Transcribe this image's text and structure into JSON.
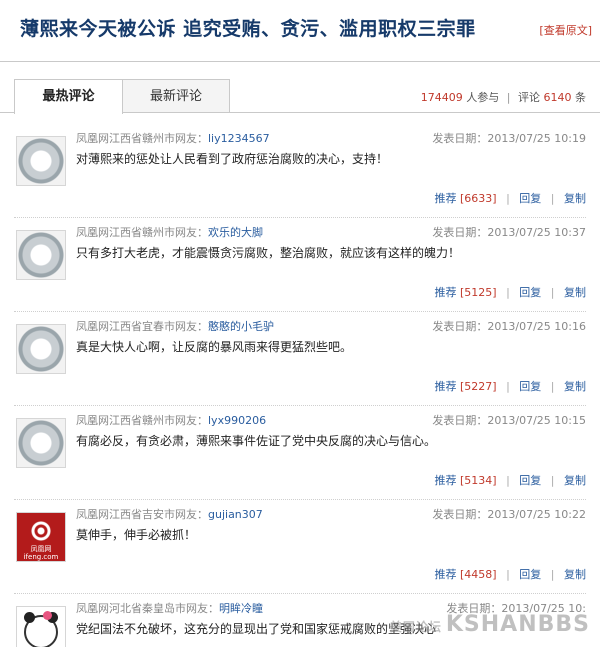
{
  "article": {
    "headline": "薄熙来今天被公诉 追究受贿、贪污、滥用职权三宗罪",
    "view_original": "[查看原文]"
  },
  "tabs": {
    "hot": "最热评论",
    "latest": "最新评论"
  },
  "stats": {
    "participants": "174409",
    "participants_suffix": "人参与",
    "comments_prefix": "评论",
    "comments": "6140",
    "comments_suffix": "条"
  },
  "actions": {
    "like": "推荐",
    "reply": "回复",
    "copy": "复制"
  },
  "comments": [
    {
      "source": "凤凰网江西省赣州市网友：",
      "user": "liy1234567",
      "date": "发表日期：2013/07/25 10:19",
      "text": "对薄熙来的惩处让人民看到了政府惩治腐败的决心，支持！",
      "likes": "[6633]",
      "avatar": "default"
    },
    {
      "source": "凤凰网江西省赣州市网友：",
      "user": "欢乐的大脚",
      "date": "发表日期：2013/07/25 10:37",
      "text": "只有多打大老虎，才能震慑贪污腐败，整治腐败，就应该有这样的魄力！",
      "likes": "[5125]",
      "avatar": "default"
    },
    {
      "source": "凤凰网江西省宜春市网友：",
      "user": "憨憨的小毛驴",
      "date": "发表日期：2013/07/25 10:16",
      "text": "真是大快人心啊，让反腐的暴风雨来得更猛烈些吧。",
      "likes": "[5227]",
      "avatar": "default"
    },
    {
      "source": "凤凰网江西省赣州市网友：",
      "user": "lyx990206",
      "date": "发表日期：2013/07/25 10:15",
      "text": "有腐必反，有贪必肃，薄熙来事件佐证了党中央反腐的决心与信心。",
      "likes": "[5134]",
      "avatar": "default"
    },
    {
      "source": "凤凰网江西省吉安市网友：",
      "user": "gujian307",
      "date": "发表日期：2013/07/25 10:22",
      "text": "莫伸手，伸手必被抓！",
      "likes": "[4458]",
      "avatar": "logo"
    },
    {
      "source": "凤凰网河北省秦皇岛市网友：",
      "user": "明眸冷瞳",
      "date": "发表日期：2013/07/25 10:",
      "text": "党纪国法不允破坏，这充分的显现出了党和国家惩戒腐败的坚强决心",
      "likes": "",
      "avatar": "panda"
    }
  ],
  "avatar_logo": {
    "line1": "凤凰网",
    "line2": "ifeng.com"
  },
  "watermark": {
    "small": "美国论坛",
    "large": "KSHANBBS"
  },
  "colors": {
    "headline": "#163a6a",
    "link": "#2a5d9f",
    "accent": "#c0392b"
  }
}
